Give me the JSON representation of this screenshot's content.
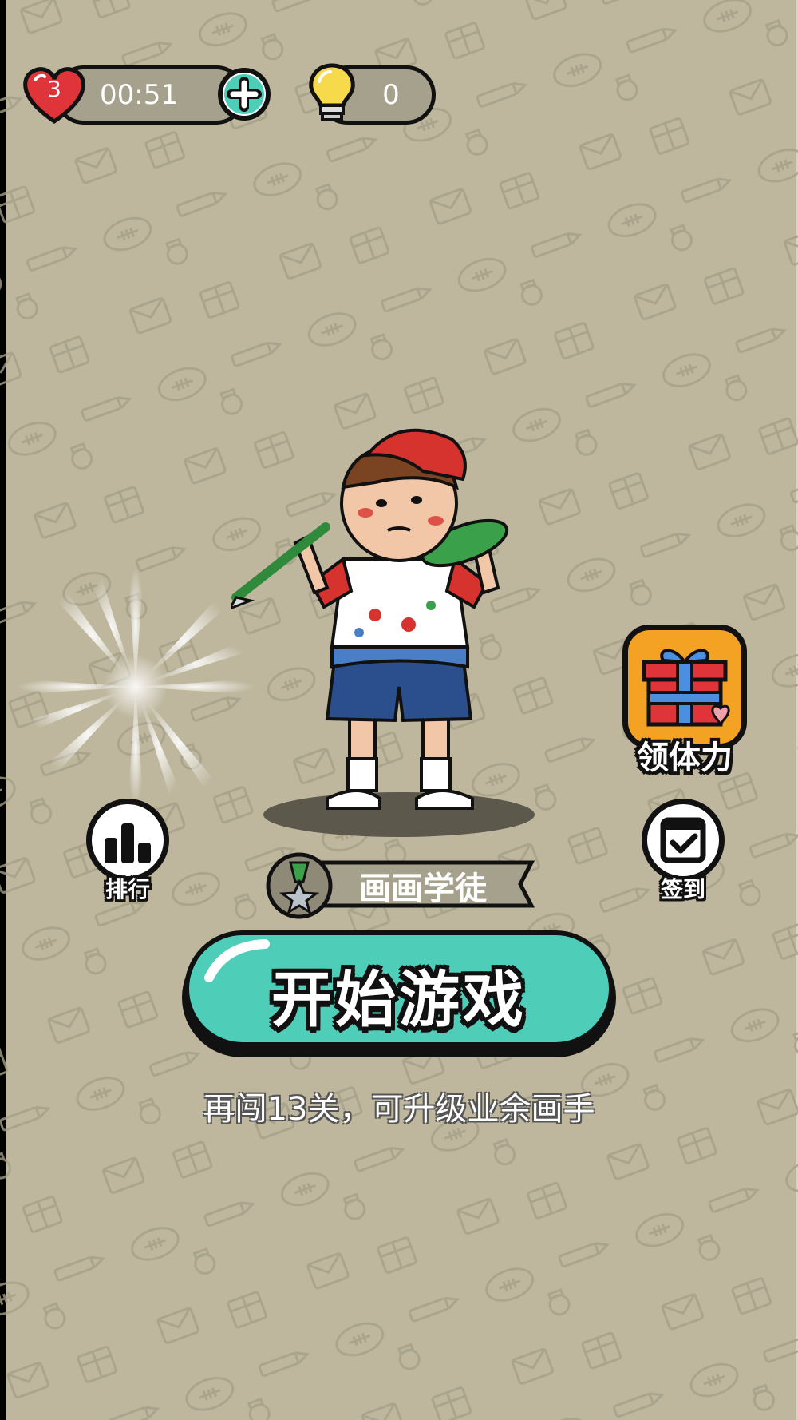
{
  "hud": {
    "lives": "3",
    "timer": "00:51",
    "hints": "0"
  },
  "icons": {
    "heart": "heart-icon",
    "plus": "plus-icon",
    "bulb": "lightbulb-icon",
    "rank": "bar-chart-icon",
    "checkin": "calendar-check-icon",
    "gift": "gift-icon",
    "medal": "medal-icon"
  },
  "side_buttons": {
    "rank_label": "排行",
    "checkin_label": "签到",
    "gift_label": "领体力"
  },
  "player": {
    "title": "画画学徒"
  },
  "start": {
    "label": "开始游戏",
    "progress_hint": "再闯13关，可升级业余画手"
  },
  "colors": {
    "background": "#beb79e",
    "accent_teal": "#4ecdb9",
    "gift_orange": "#f4a224",
    "heart_red": "#e0343b"
  }
}
